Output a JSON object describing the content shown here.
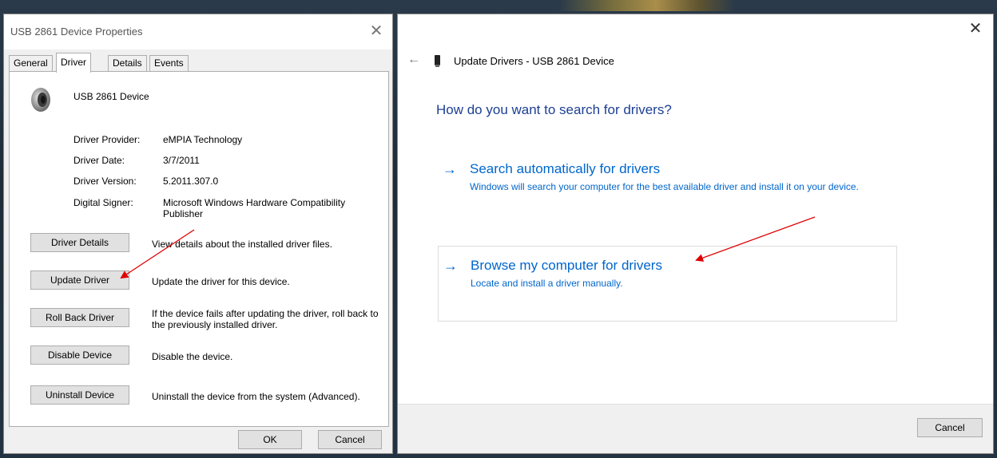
{
  "properties_dialog": {
    "title": "USB 2861 Device Properties",
    "close_glyph": "✕",
    "tabs": [
      {
        "label": "General"
      },
      {
        "label": "Driver"
      },
      {
        "label": "Details"
      },
      {
        "label": "Events"
      }
    ],
    "active_tab": "Driver",
    "device_name": "USB 2861 Device",
    "info": [
      {
        "label": "Driver Provider:",
        "value": "eMPIA Technology"
      },
      {
        "label": "Driver Date:",
        "value": "3/7/2011"
      },
      {
        "label": "Driver Version:",
        "value": "5.2011.307.0"
      },
      {
        "label": "Digital Signer:",
        "value": "Microsoft Windows Hardware Compatibility Publisher"
      }
    ],
    "actions": [
      {
        "label": "Driver Details",
        "description": "View details about the installed driver files."
      },
      {
        "label": "Update Driver",
        "description": "Update the driver for this device."
      },
      {
        "label": "Roll Back Driver",
        "description": "If the device fails after updating the driver, roll back to the previously installed driver."
      },
      {
        "label": "Disable Device",
        "description": "Disable the device."
      },
      {
        "label": "Uninstall Device",
        "description": "Uninstall the device from the system (Advanced)."
      }
    ],
    "ok_label": "OK",
    "cancel_label": "Cancel"
  },
  "update_wizard": {
    "close_glyph": "✕",
    "back_glyph": "←",
    "title": "Update Drivers - USB 2861 Device",
    "heading": "How do you want to search for drivers?",
    "options": [
      {
        "arrow": "→",
        "title": "Search automatically for drivers",
        "description": "Windows will search your computer for the best available driver and install it on your device."
      },
      {
        "arrow": "→",
        "title": "Browse my computer for drivers",
        "description": "Locate and install a driver manually."
      }
    ],
    "cancel_label": "Cancel"
  },
  "colors": {
    "link_blue": "#0066cc",
    "heading_blue": "#1c3f94",
    "annotation_red": "#e00000"
  }
}
